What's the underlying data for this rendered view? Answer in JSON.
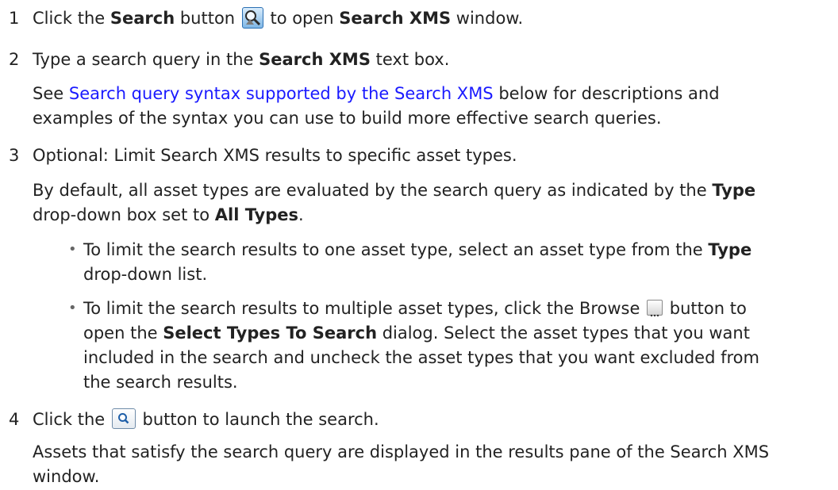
{
  "steps": [
    {
      "number": "1",
      "pre": "Click the ",
      "b1": "Search",
      "mid": " button ",
      "post": " to open ",
      "b2": "Search XMS",
      "end": " window."
    },
    {
      "number": "2",
      "pre": "Type a search query in the ",
      "b1": "Search XMS",
      "end": " text box.",
      "see_pre": "See ",
      "see_link": "Search query syntax supported by the Search XMS",
      "see_post": " below for descriptions and",
      "see_line2": "examples of the syntax you can use to build more effective search queries."
    },
    {
      "number": "3",
      "text": "Optional: Limit Search XMS results to specific asset types.",
      "para_line1_pre": "By default, all asset types are evaluated by the search query as indicated by the ",
      "para_line1_b": "Type",
      "para_line2_pre": "drop-down box set to ",
      "para_line2_b": "All Types",
      "para_line2_end": ".",
      "bullets": [
        {
          "line1_pre": "To limit the search results to one asset type, select an asset type from the ",
          "line1_b": "Type",
          "line2": "drop-down list."
        },
        {
          "line1_pre": "To limit the search results to multiple asset types, click the Browse ",
          "line1_post": " button to",
          "line2_pre": "open the ",
          "line2_b": "Select Types To Search",
          "line2_post": " dialog. Select the asset types that you want",
          "line3": "included in the search and uncheck the asset types that you want excluded from",
          "line4": "the search results."
        }
      ]
    },
    {
      "number": "4",
      "pre": "Click the ",
      "post": " button to launch the search.",
      "result_line1": "Assets that satisfy the search query are displayed in the results pane of the Search XMS",
      "result_line2": "window."
    }
  ],
  "bullet_glyph": "•",
  "icons": {
    "search_button": "search-xms-icon",
    "browse_button": "browse-ellipsis-icon",
    "launch_button": "magnifier-icon"
  }
}
